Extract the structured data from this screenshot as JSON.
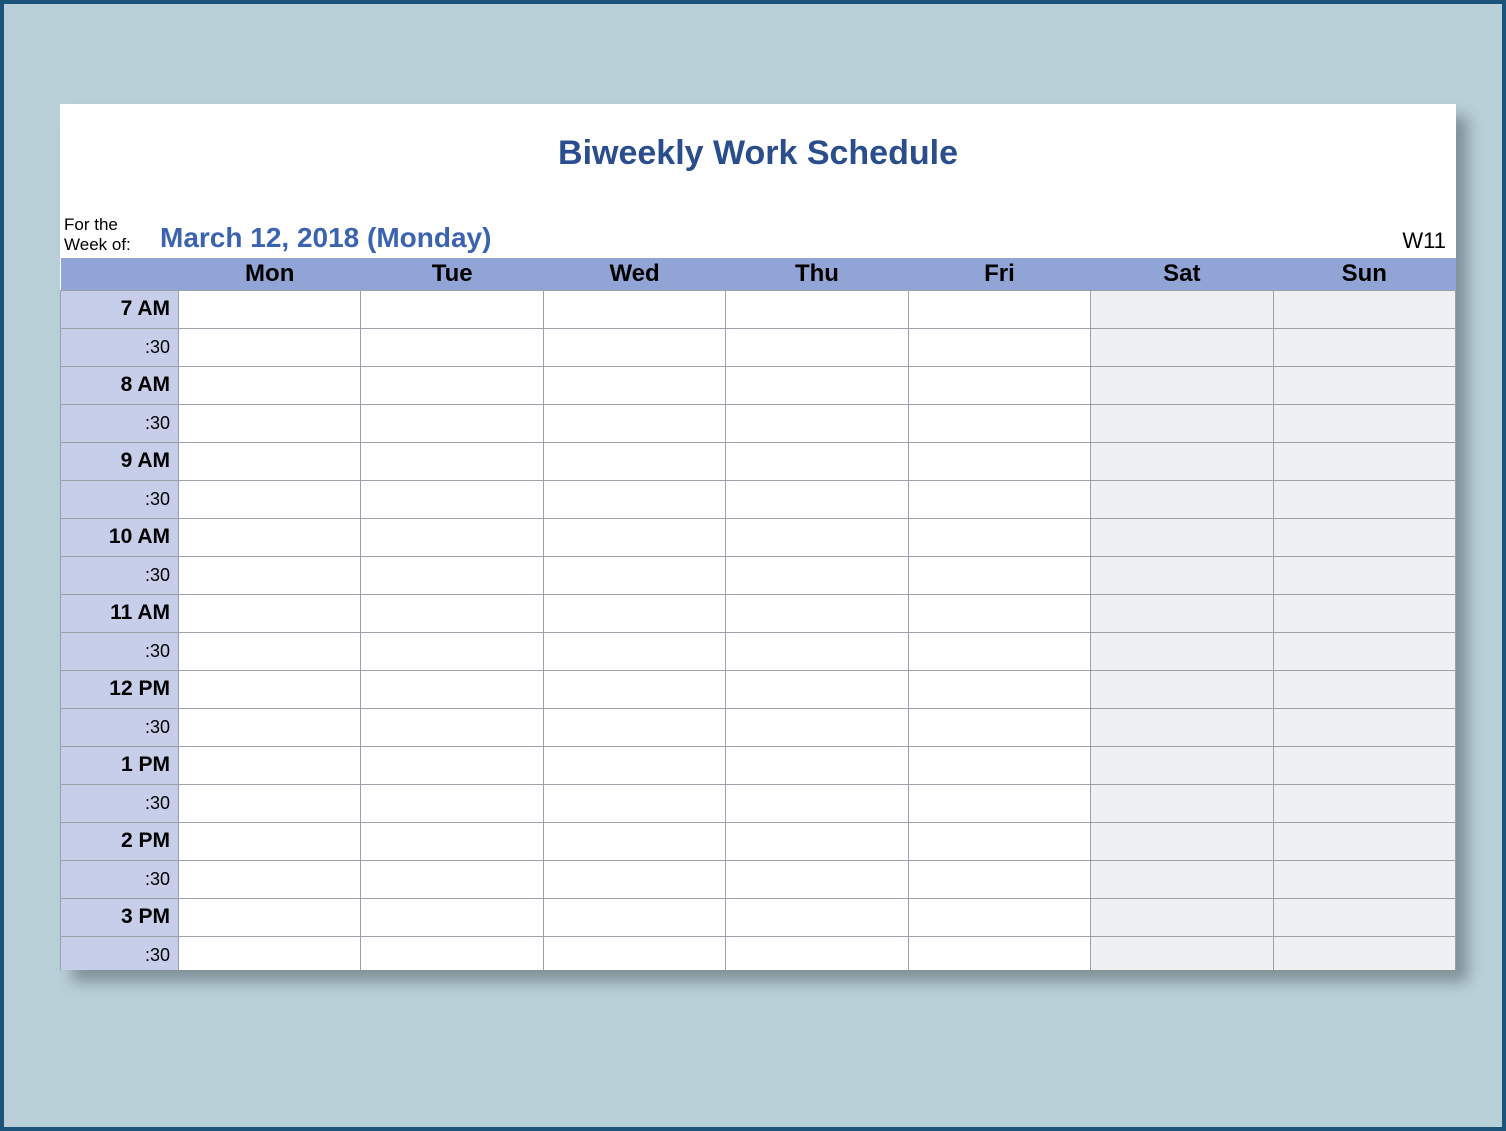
{
  "title": "Biweekly Work Schedule",
  "meta": {
    "label": "For the Week of:",
    "date": "March 12, 2018 (Monday)",
    "week_no": "W11"
  },
  "days": [
    "Mon",
    "Tue",
    "Wed",
    "Thu",
    "Fri",
    "Sat",
    "Sun"
  ],
  "weekend_days": [
    "Sat",
    "Sun"
  ],
  "hours": [
    "7 AM",
    "8 AM",
    "9 AM",
    "10 AM",
    "11 AM",
    "12 PM",
    "1 PM",
    "2 PM",
    "3 PM"
  ],
  "half_label": ":30"
}
